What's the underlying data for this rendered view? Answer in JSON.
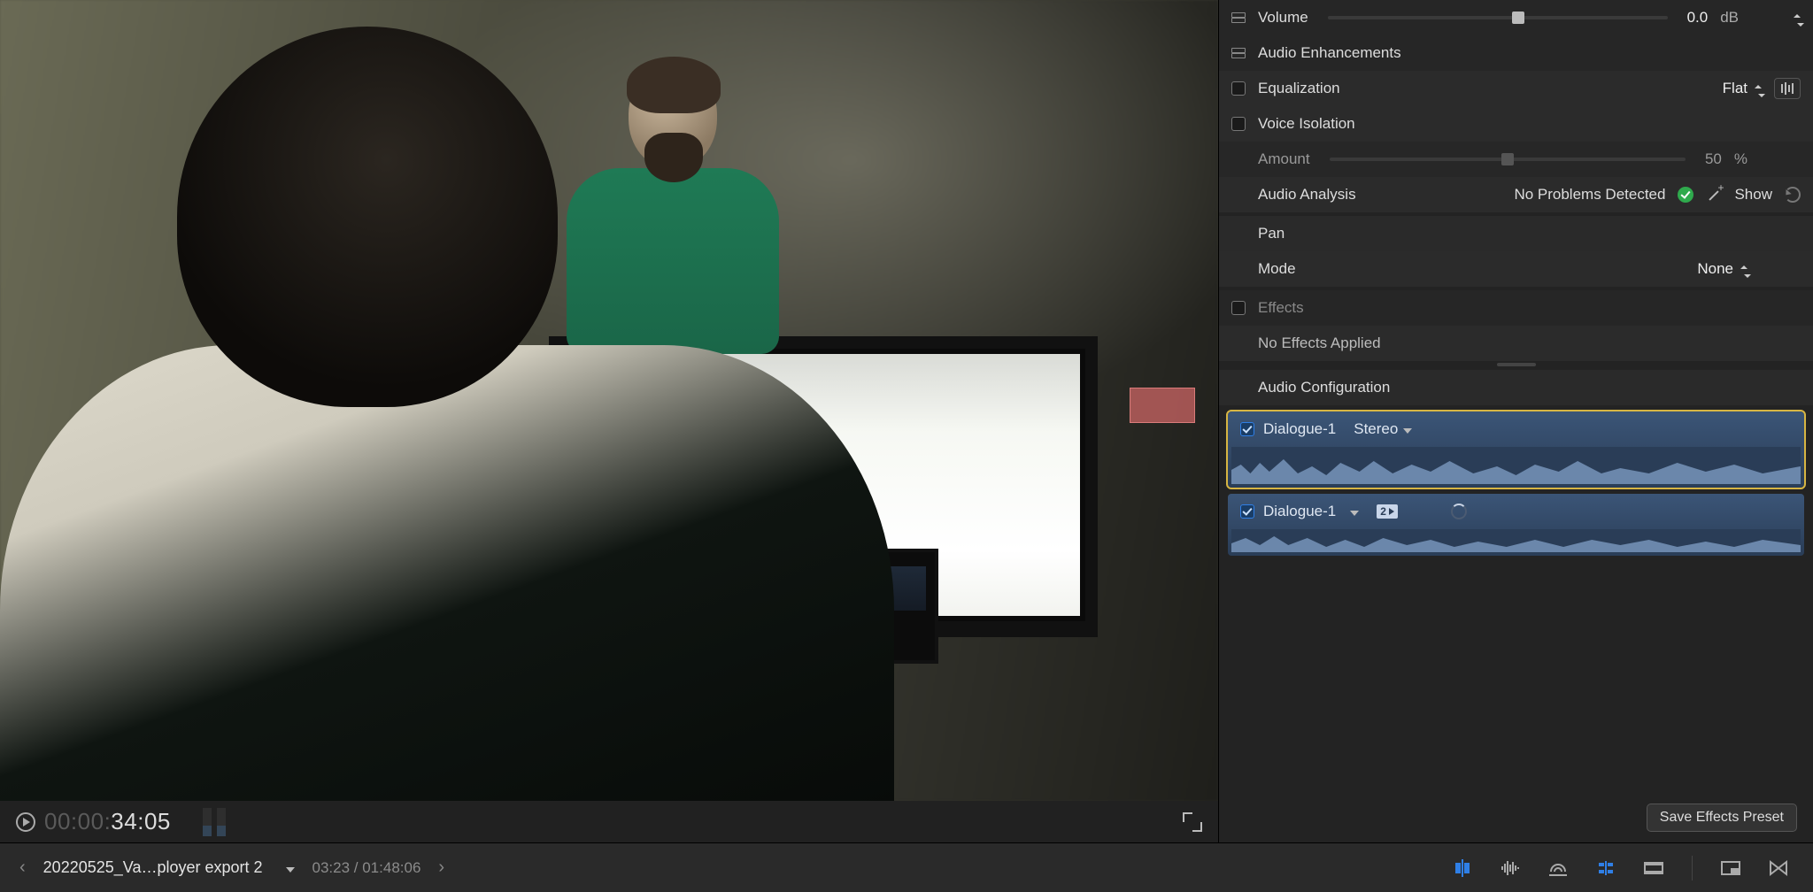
{
  "inspector": {
    "volume": {
      "label": "Volume",
      "value": "0.0",
      "unit": "dB",
      "knob_pct": 56
    },
    "audio_enh_label": "Audio Enhancements",
    "equalization": {
      "label": "Equalization",
      "checked": false,
      "preset": "Flat"
    },
    "voice_isolation": {
      "label": "Voice Isolation",
      "checked": false
    },
    "amount": {
      "label": "Amount",
      "value": "50",
      "unit": "%",
      "knob_pct": 50
    },
    "analysis": {
      "label": "Audio Analysis",
      "status": "No Problems Detected",
      "show": "Show"
    },
    "pan": {
      "label": "Pan"
    },
    "mode": {
      "label": "Mode",
      "value": "None"
    },
    "effects": {
      "label": "Effects",
      "checked": false,
      "none": "No Effects Applied"
    },
    "audio_config_label": "Audio Configuration",
    "tracks": [
      {
        "name": "Dialogue-1",
        "checked": true,
        "format": "Stereo"
      },
      {
        "name": "Dialogue-1",
        "checked": true,
        "badge": "2"
      }
    ],
    "save_preset": "Save Effects Preset"
  },
  "viewer": {
    "timecode_dim": "00:00:",
    "timecode_main": "34:05"
  },
  "bottom": {
    "clip_name": "20220525_Va…ployer export 2",
    "time": "03:23 / 01:48:06"
  }
}
